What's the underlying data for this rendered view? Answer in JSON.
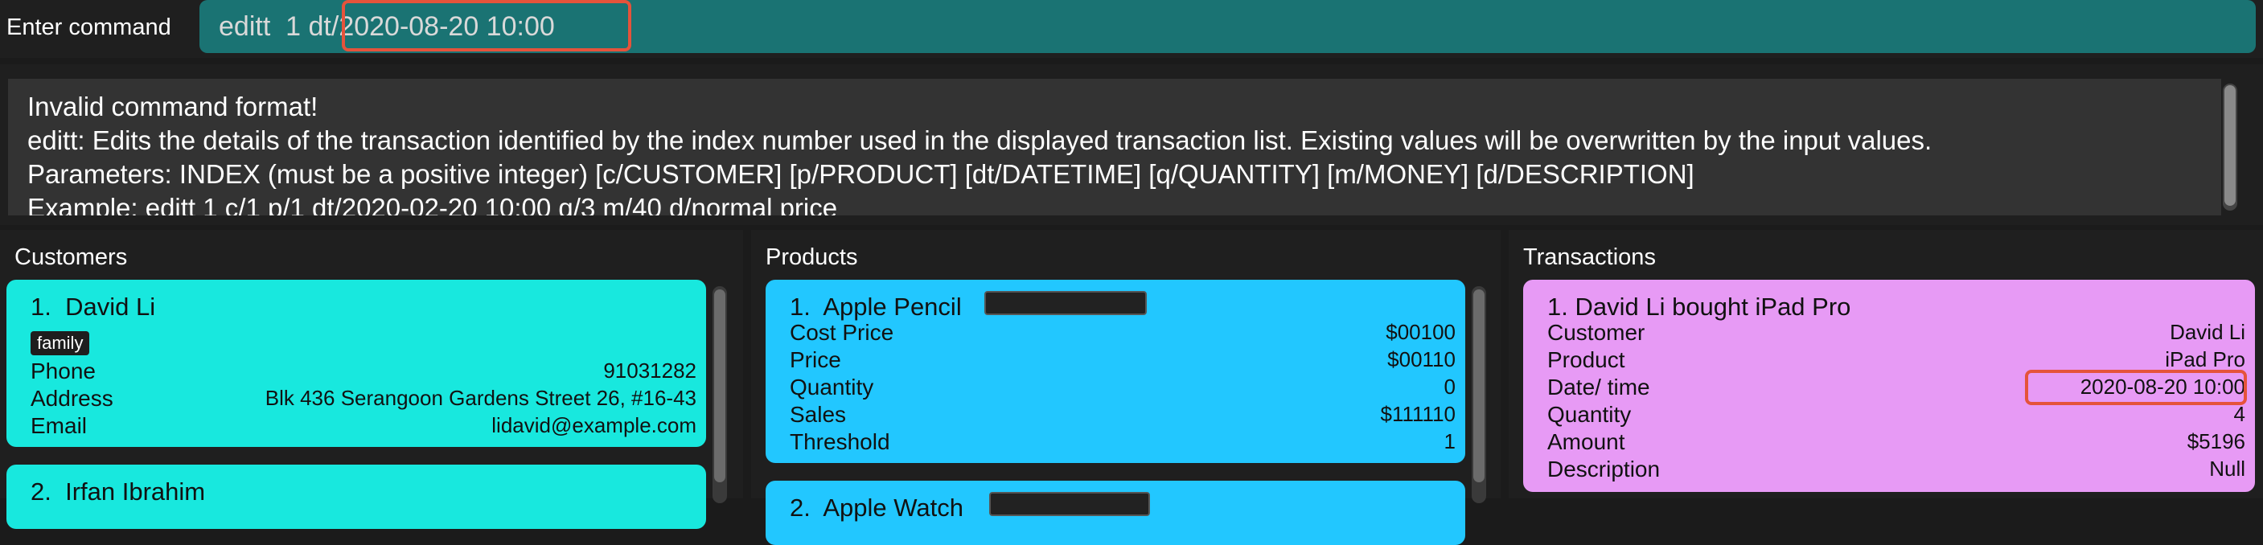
{
  "command": {
    "label": "Enter command",
    "value": "editt  1 dt/2020-08-20 10:00"
  },
  "result": {
    "lines": [
      "Invalid command format!",
      "editt: Edits the details of the transaction identified by the index number used in the displayed transaction list. Existing values will be overwritten by the input values.",
      "Parameters: INDEX (must be a positive integer) [c/CUSTOMER] [p/PRODUCT] [dt/DATETIME] [q/QUANTITY] [m/MONEY] [d/DESCRIPTION]",
      "Example: editt 1 c/1 p/1 dt/2020-02-20 10:00 q/3 m/40 d/normal price"
    ]
  },
  "customers": {
    "title": "Customers",
    "items": [
      {
        "title": "1.  David Li",
        "tag": "family",
        "phone_label": "Phone",
        "phone": "91031282",
        "address_label": "Address",
        "address": "Blk 436 Serangoon Gardens Street 26, #16-43",
        "email_label": "Email",
        "email": "lidavid@example.com"
      },
      {
        "title": "2.  Irfan Ibrahim"
      }
    ]
  },
  "products": {
    "title": "Products",
    "items": [
      {
        "title": "1.  Apple Pencil",
        "cost_label": "Cost Price",
        "cost": "$00100",
        "price_label": "Price",
        "price": "$00110",
        "quantity_label": "Quantity",
        "quantity": "0",
        "sales_label": "Sales",
        "sales": "$111110",
        "threshold_label": "Threshold",
        "threshold": "1"
      },
      {
        "title": "2.  Apple Watch"
      }
    ]
  },
  "transactions": {
    "title": "Transactions",
    "items": [
      {
        "title": "1. David Li bought iPad Pro",
        "customer_label": "Customer",
        "customer": "David Li",
        "product_label": "Product",
        "product": "iPad Pro",
        "datetime_label": "Date/ time",
        "datetime": "2020-08-20 10:00",
        "quantity_label": "Quantity",
        "quantity": "4",
        "amount_label": "Amount",
        "amount": "$5196",
        "description_label": "Description",
        "description": "Null"
      }
    ]
  },
  "colors": {
    "command_bg": "#1a7373",
    "customer_card": "#18e8de",
    "product_card": "#22c7ff",
    "transaction_card": "#e79af5",
    "highlight": "#e5533b"
  }
}
